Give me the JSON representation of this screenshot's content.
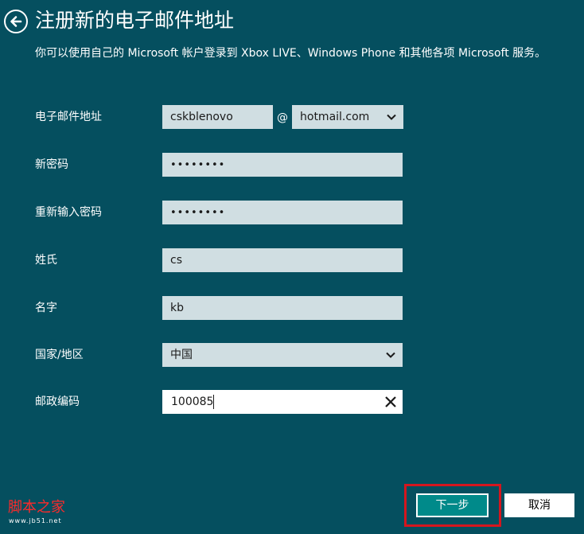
{
  "header": {
    "back_icon": "back-arrow-circle-icon",
    "title": "注册新的电子邮件地址",
    "description": "你可以使用自己的 Microsoft 帐户登录到 Xbox LIVE、Windows Phone 和其他各项 Microsoft 服务。"
  },
  "form": {
    "email": {
      "label": "电子邮件地址",
      "username": "cskblenovo",
      "at": "@",
      "domain": "hotmail.com"
    },
    "new_password": {
      "label": "新密码",
      "value": "••••••••"
    },
    "confirm_password": {
      "label": "重新输入密码",
      "value": "••••••••"
    },
    "last_name": {
      "label": "姓氏",
      "value": "cs"
    },
    "first_name": {
      "label": "名字",
      "value": "kb"
    },
    "country": {
      "label": "国家/地区",
      "value": "中国"
    },
    "postal_code": {
      "label": "邮政编码",
      "value": "100085"
    }
  },
  "footer": {
    "next_label": "下一步",
    "cancel_label": "取消"
  },
  "watermark": {
    "main": "脚本之家",
    "sub": "www.jb51.net"
  },
  "colors": {
    "background": "#054f5f",
    "field": "#d0dee2",
    "accent": "#008a8a",
    "highlight": "#d5161e"
  }
}
